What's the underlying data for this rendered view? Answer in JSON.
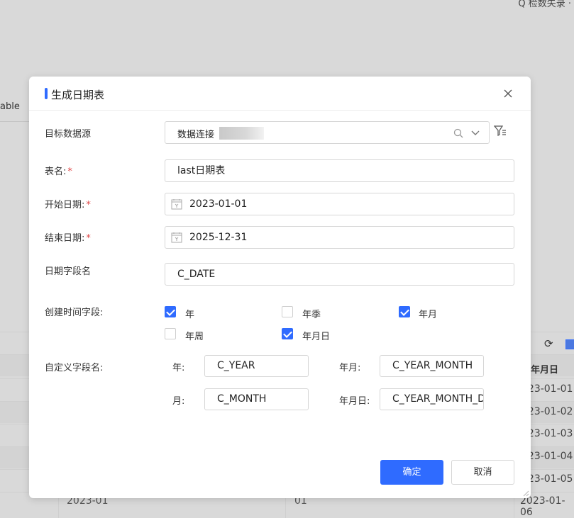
{
  "background": {
    "search_label": "Q 检数失录 ·",
    "tab_label": "able",
    "grid_dates": [
      "023-01-01",
      "023-01-02",
      "023-01-03",
      "023-01-04",
      "023-01-05",
      "2023-01-06"
    ],
    "header_label": "年月日",
    "cell_year_month": "2023-01",
    "cell_month": "01"
  },
  "modal": {
    "title": "生成日期表",
    "fields": {
      "datasource_label": "目标数据源",
      "datasource_value": "数据连接",
      "table_name_label": "表名:",
      "table_name_value": "last日期表",
      "start_date_label": "开始日期:",
      "start_date_value": "2023-01-01",
      "end_date_label": "结束日期:",
      "end_date_value": "2025-12-31",
      "date_field_label": "日期字段名",
      "date_field_value": "C_DATE",
      "required_mark": "*"
    },
    "time_fields": {
      "label": "创建时间字段:",
      "options": [
        {
          "label": "年",
          "checked": true
        },
        {
          "label": "年季",
          "checked": false
        },
        {
          "label": "年月",
          "checked": true
        },
        {
          "label": "年周",
          "checked": false
        },
        {
          "label": "年月日",
          "checked": true
        }
      ]
    },
    "custom_names": {
      "label": "自定义字段名:",
      "year_label": "年:",
      "year_value": "C_YEAR",
      "year_month_label": "年月:",
      "year_month_value": "C_YEAR_MONTH",
      "month_label": "月:",
      "month_value": "C_MONTH",
      "year_month_day_label": "年月日:",
      "year_month_day_value": "C_YEAR_MONTH_DAY"
    },
    "buttons": {
      "ok": "确定",
      "cancel": "取消"
    }
  },
  "colors": {
    "primary": "#2f6bff",
    "required": "#e04848",
    "overlay": "#d9d9d9"
  }
}
